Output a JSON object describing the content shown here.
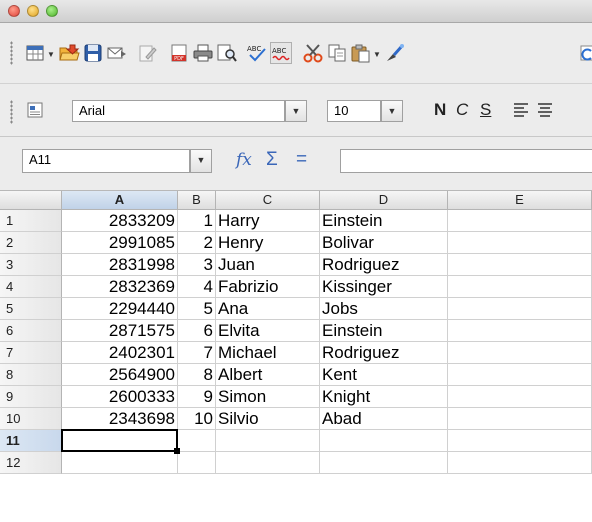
{
  "window": {
    "traffic_lights": [
      "close",
      "minimize",
      "zoom"
    ]
  },
  "toolbar": {
    "standard_icons": [
      "new-document-icon",
      "open-folder-icon",
      "save-icon",
      "email-icon",
      "edit-file-icon",
      "export-pdf-icon",
      "print-icon",
      "page-preview-icon",
      "spellcheck-icon",
      "autospellcheck-icon",
      "cut-icon",
      "copy-icon",
      "paste-icon",
      "clone-formatting-icon",
      "undo-icon"
    ]
  },
  "formatting": {
    "font_name": "Arial",
    "font_size": "10",
    "bold_label": "N",
    "italic_label": "C",
    "underline_label": "S"
  },
  "formula_bar": {
    "name_box": "A11",
    "function_wizard": "fx",
    "sum_symbol": "Σ",
    "equals_symbol": "=",
    "formula_value": ""
  },
  "sheet": {
    "columns": [
      "A",
      "B",
      "C",
      "D",
      "E"
    ],
    "selected_column": "A",
    "selected_row": "11",
    "active_cell": "A11",
    "rows": [
      {
        "row": "1",
        "A": "2833209",
        "B": "1",
        "C": "Harry",
        "D": "Einstein"
      },
      {
        "row": "2",
        "A": "2991085",
        "B": "2",
        "C": "Henry",
        "D": "Bolivar"
      },
      {
        "row": "3",
        "A": "2831998",
        "B": "3",
        "C": "Juan",
        "D": "Rodriguez"
      },
      {
        "row": "4",
        "A": "2832369",
        "B": "4",
        "C": "Fabrizio",
        "D": "Kissinger"
      },
      {
        "row": "5",
        "A": "2294440",
        "B": "5",
        "C": "Ana",
        "D": "Jobs"
      },
      {
        "row": "6",
        "A": "2871575",
        "B": "6",
        "C": "Elvita",
        "D": "Einstein"
      },
      {
        "row": "7",
        "A": "2402301",
        "B": "7",
        "C": "Michael",
        "D": "Rodriguez"
      },
      {
        "row": "8",
        "A": "2564900",
        "B": "8",
        "C": "Albert",
        "D": "Kent"
      },
      {
        "row": "9",
        "A": "2600333",
        "B": "9",
        "C": "Simon",
        "D": "Knight"
      },
      {
        "row": "10",
        "A": "2343698",
        "B": "10",
        "C": "Silvio",
        "D": "Abad"
      },
      {
        "row": "11",
        "A": "",
        "B": "",
        "C": "",
        "D": ""
      },
      {
        "row": "12",
        "A": "",
        "B": "",
        "C": "",
        "D": ""
      }
    ]
  }
}
